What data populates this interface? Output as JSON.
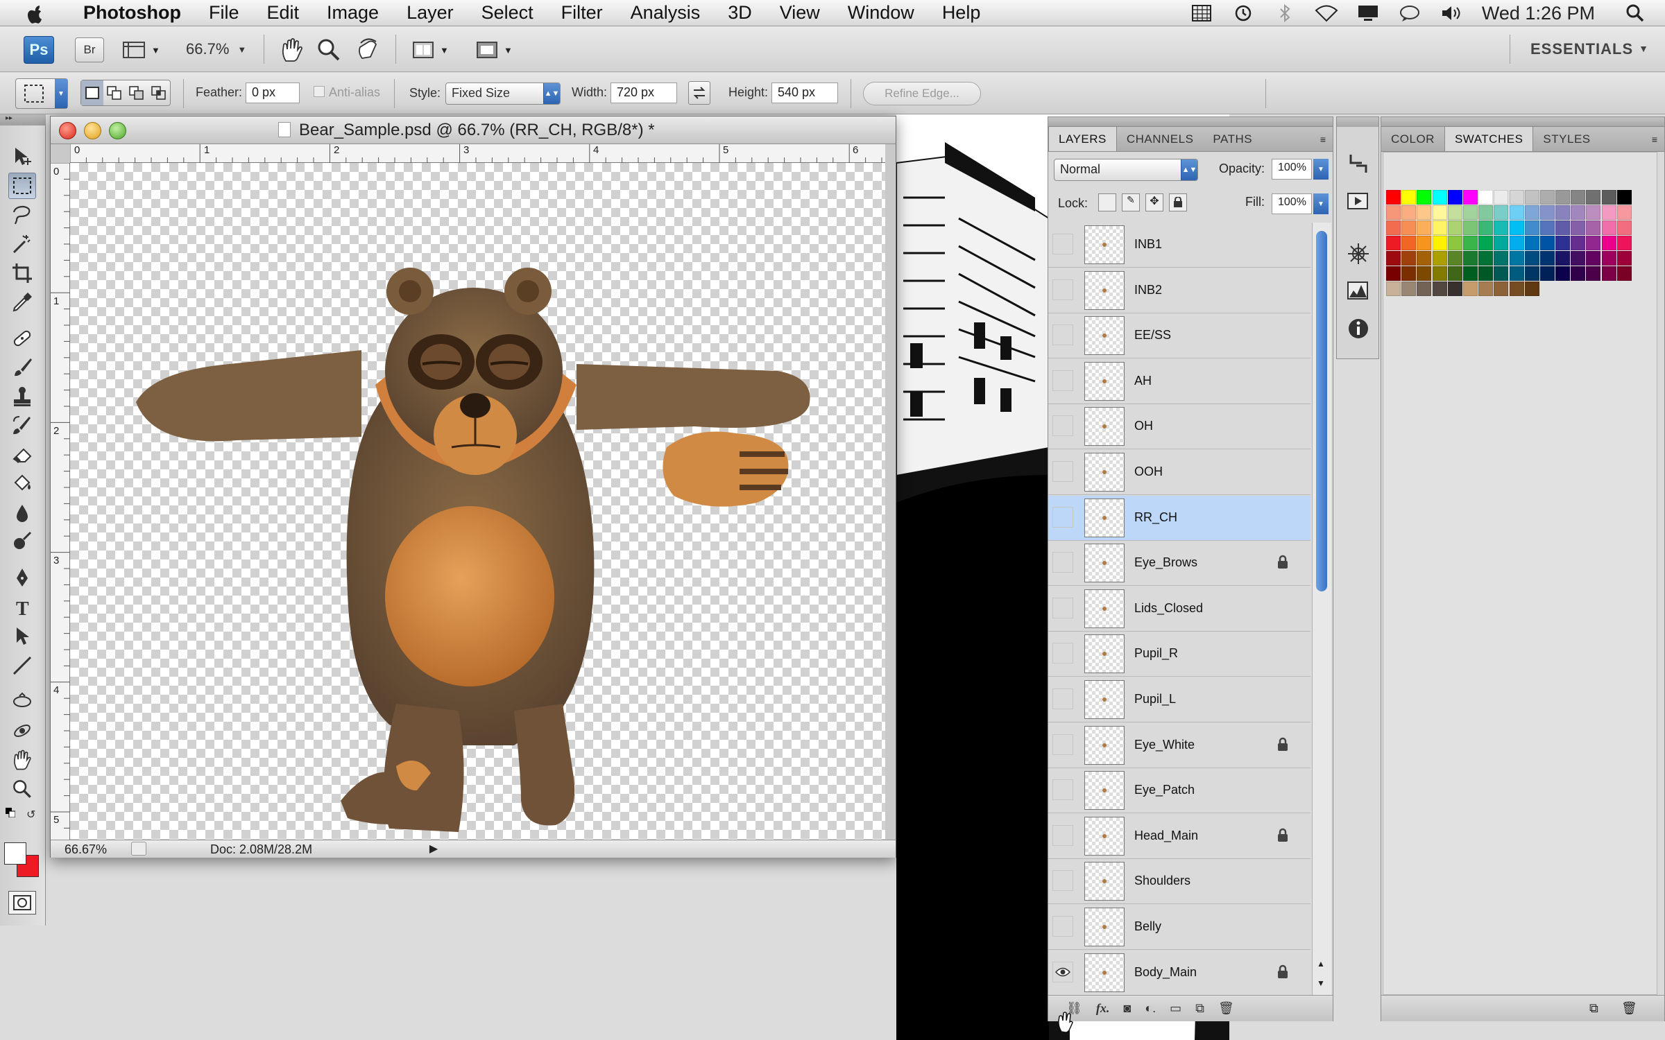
{
  "menubar": {
    "app_name": "Photoshop",
    "items": [
      "File",
      "Edit",
      "Image",
      "Layer",
      "Select",
      "Filter",
      "Analysis",
      "3D",
      "View",
      "Window",
      "Help"
    ],
    "clock": "Wed 1:26 PM",
    "status_icons": [
      "grid-icon",
      "time-machine-icon",
      "bluetooth-icon",
      "wifi-icon",
      "display-icon",
      "chat-icon",
      "volume-icon",
      "spotlight-icon"
    ]
  },
  "appbar": {
    "ps_label": "Ps",
    "bridge_label": "Br",
    "zoom": "66.7%",
    "workspace": "ESSENTIALS"
  },
  "options": {
    "feather_label": "Feather:",
    "feather_value": "0 px",
    "antialias_label": "Anti-alias",
    "style_label": "Style:",
    "style_value": "Fixed Size",
    "width_label": "Width:",
    "width_value": "720 px",
    "height_label": "Height:",
    "height_value": "540 px",
    "refine_label": "Refine Edge..."
  },
  "document": {
    "title": "Bear_Sample.psd @ 66.7% (RR_CH, RGB/8*) *",
    "zoom_status": "66.67%",
    "doc_size": "Doc: 2.08M/28.2M",
    "ruler_h": [
      "0",
      "1",
      "2",
      "3",
      "4",
      "5",
      "6"
    ],
    "ruler_v": [
      "0",
      "1",
      "2",
      "3",
      "4",
      "5"
    ]
  },
  "layers_panel": {
    "tabs": [
      "LAYERS",
      "CHANNELS",
      "PATHS"
    ],
    "blend_mode": "Normal",
    "opacity_label": "Opacity:",
    "opacity_value": "100%",
    "lock_label": "Lock:",
    "fill_label": "Fill:",
    "fill_value": "100%",
    "layers": [
      {
        "name": "INB1",
        "visible": false,
        "locked": false,
        "active": false
      },
      {
        "name": "INB2",
        "visible": false,
        "locked": false,
        "active": false
      },
      {
        "name": "EE/SS",
        "visible": false,
        "locked": false,
        "active": false
      },
      {
        "name": "AH",
        "visible": false,
        "locked": false,
        "active": false
      },
      {
        "name": "OH",
        "visible": false,
        "locked": false,
        "active": false
      },
      {
        "name": "OOH",
        "visible": false,
        "locked": false,
        "active": false
      },
      {
        "name": "RR_CH",
        "visible": false,
        "locked": false,
        "active": true
      },
      {
        "name": "Eye_Brows",
        "visible": false,
        "locked": true,
        "active": false
      },
      {
        "name": "Lids_Closed",
        "visible": false,
        "locked": false,
        "active": false
      },
      {
        "name": "Pupil_R",
        "visible": false,
        "locked": false,
        "active": false
      },
      {
        "name": "Pupil_L",
        "visible": false,
        "locked": false,
        "active": false
      },
      {
        "name": "Eye_White",
        "visible": false,
        "locked": true,
        "active": false
      },
      {
        "name": "Eye_Patch",
        "visible": false,
        "locked": false,
        "active": false
      },
      {
        "name": "Head_Main",
        "visible": false,
        "locked": true,
        "active": false
      },
      {
        "name": "Shoulders",
        "visible": false,
        "locked": false,
        "active": false
      },
      {
        "name": "Belly",
        "visible": false,
        "locked": false,
        "active": false
      },
      {
        "name": "Body_Main",
        "visible": true,
        "locked": true,
        "active": false
      }
    ],
    "footer_icons": [
      "link-icon",
      "fx-icon",
      "mask-icon",
      "adjustment-icon",
      "group-icon",
      "new-layer-icon",
      "trash-icon"
    ]
  },
  "swatches_panel": {
    "tabs": [
      "COLOR",
      "SWATCHES",
      "STYLES"
    ],
    "colors": {
      "row1": [
        "#ff0000",
        "#ffff00",
        "#00ff00",
        "#00ffff",
        "#0000ff",
        "#ff00ff",
        "#ffffff",
        "#ebebeb",
        "#d6d6d6",
        "#c2c2c2",
        "#adadad",
        "#999999",
        "#858585",
        "#707070",
        "#5c5c5c",
        "#000000"
      ],
      "row2": [
        "#f7977a",
        "#f9ad81",
        "#fdc68a",
        "#fff79a",
        "#c4df9b",
        "#a3d39c",
        "#82ca9d",
        "#7bcdc8",
        "#6ecff6",
        "#7ea7d8",
        "#8493ca",
        "#8882be",
        "#a187be",
        "#bc8dbf",
        "#f49ac2",
        "#f6989d"
      ],
      "row3": [
        "#f26c4f",
        "#f68e55",
        "#fbaf5c",
        "#fff467",
        "#acd372",
        "#7cc576",
        "#3bb878",
        "#1abbb4",
        "#00bff3",
        "#438ccb",
        "#5574b9",
        "#605ca8",
        "#855fa8",
        "#a763a8",
        "#f06ea9",
        "#f26d7d"
      ],
      "row4": [
        "#ed1c24",
        "#f26522",
        "#f7941d",
        "#fff200",
        "#8dc63f",
        "#39b54a",
        "#00a651",
        "#00a99d",
        "#00aeef",
        "#0072bc",
        "#0054a6",
        "#2e3192",
        "#662d91",
        "#92278f",
        "#ec008c",
        "#ed145b"
      ],
      "row5": [
        "#9e0b0f",
        "#a0410d",
        "#a3620a",
        "#aba000",
        "#598527",
        "#1a7b30",
        "#007236",
        "#00746b",
        "#0076a3",
        "#004b80",
        "#003471",
        "#1b1464",
        "#440e62",
        "#630460",
        "#9e005d",
        "#9e0039"
      ],
      "row6": [
        "#790000",
        "#7b2e00",
        "#7d4900",
        "#827b00",
        "#406618",
        "#005e20",
        "#005826",
        "#005952",
        "#005b7f",
        "#003663",
        "#002157",
        "#0d004c",
        "#32004b",
        "#4b0049",
        "#7b0046",
        "#7a0026"
      ],
      "row7": [
        "#c7b299",
        "#998675",
        "#736357",
        "#534741",
        "#37302d",
        "#c69c6d",
        "#a67c52",
        "#8c6239",
        "#754c24",
        "#603913"
      ]
    }
  }
}
